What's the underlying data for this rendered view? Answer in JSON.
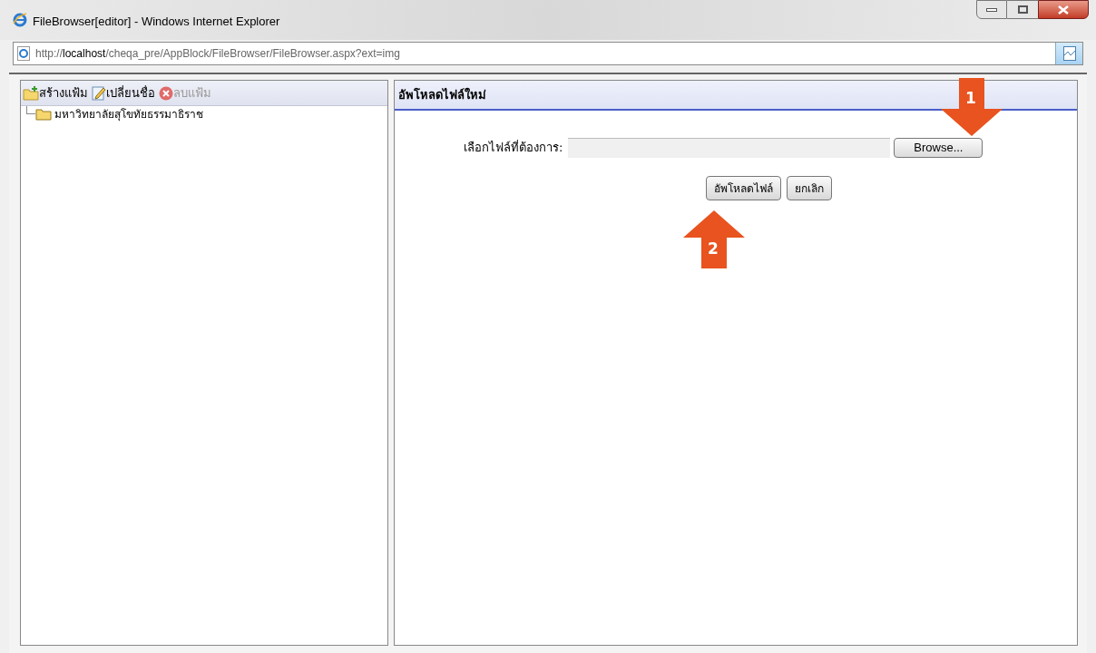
{
  "window": {
    "title": "FileBrowser[editor] - Windows Internet Explorer"
  },
  "address_bar": {
    "prefix": "http://",
    "host": "localhost",
    "path": "/cheqa_pre/AppBlock/FileBrowser/FileBrowser.aspx?ext=img"
  },
  "toolbar": [
    {
      "label": "สร้างแฟ้ม",
      "kind": "new-folder",
      "disabled": false
    },
    {
      "label": "เปลี่ยนชื่อ",
      "kind": "rename",
      "disabled": false
    },
    {
      "label": "ลบแฟ้ม",
      "kind": "delete",
      "disabled": true
    }
  ],
  "tree": [
    {
      "label": "มหาวิทยาลัยสุโขทัยธรรมาธิราช"
    }
  ],
  "upload_panel": {
    "title": "อัพโหลดไฟล์ใหม่",
    "field_label": "เลือกไฟล์ที่ต้องการ:",
    "browse_button": "Browse...",
    "buttons": [
      "อัพโหลดไฟล์",
      "ยกเลิก"
    ]
  },
  "annotations": [
    {
      "number": "1",
      "kind": "down"
    },
    {
      "number": "2",
      "kind": "up"
    }
  ]
}
